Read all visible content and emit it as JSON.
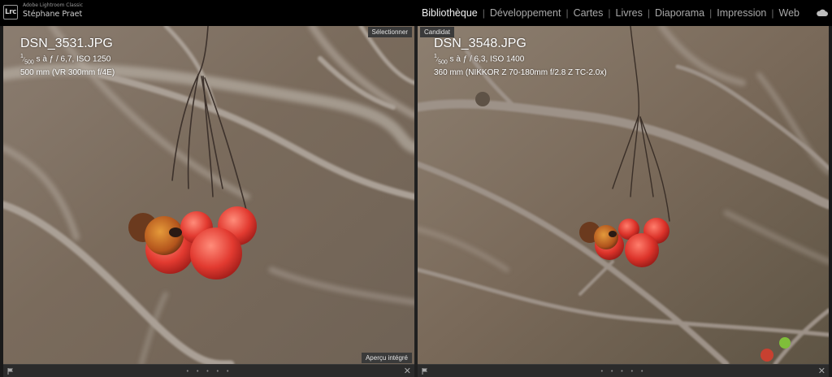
{
  "app": {
    "logo_text": "Lrc",
    "product": "Adobe Lightroom Classic",
    "user": "Stéphane Praet"
  },
  "modules": [
    {
      "label": "Bibliothèque",
      "active": true
    },
    {
      "label": "Développement",
      "active": false
    },
    {
      "label": "Cartes",
      "active": false
    },
    {
      "label": "Livres",
      "active": false
    },
    {
      "label": "Diaporama",
      "active": false
    },
    {
      "label": "Impression",
      "active": false
    },
    {
      "label": "Web",
      "active": false
    }
  ],
  "left_pane": {
    "role_label": "Sélectionner",
    "filename": "DSN_3531.JPG",
    "exposure_num": "1",
    "exposure_den": "500",
    "exposure_rest": " s à ƒ / 6,7, ISO 1250",
    "lens": "500 mm (VR 300mm f/4E)",
    "preview_label": "Aperçu intégré"
  },
  "right_pane": {
    "role_label": "Candidat",
    "filename": "DSN_3548.JPG",
    "exposure_num": "1",
    "exposure_den": "500",
    "exposure_rest": " s à ƒ / 6,3, ISO 1400",
    "lens": "360 mm (NIKKOR Z 70-180mm f/2.8 Z TC-2.0x)"
  },
  "strip": {
    "dots": "• • • • •",
    "close": "✕"
  },
  "icons": {
    "flag": "flag-icon",
    "close": "close-icon",
    "cloud": "cloud-icon"
  }
}
